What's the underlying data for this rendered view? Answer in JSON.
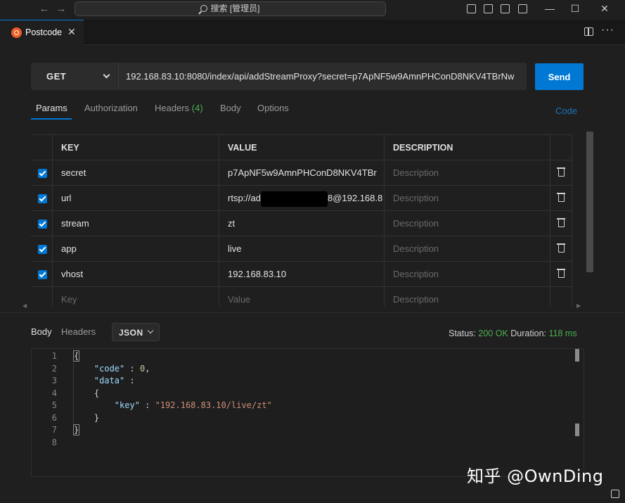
{
  "titlebar": {
    "search_text": "搜索 [管理员]"
  },
  "tab": {
    "label": "Postcode",
    "close": "✕"
  },
  "request": {
    "method": "GET",
    "url": "192.168.83.10:8080/index/api/addStreamProxy?secret=p7ApNF5w9AmnPHConD8NKV4TBrNw",
    "send_label": "Send"
  },
  "request_tabs": {
    "params": "Params",
    "authorization": "Authorization",
    "headers": "Headers",
    "headers_count": "(4)",
    "body": "Body",
    "options": "Options",
    "code": "Code"
  },
  "params_table": {
    "headers": {
      "key": "KEY",
      "value": "VALUE",
      "description": "DESCRIPTION"
    },
    "rows": [
      {
        "key": "secret",
        "value": "p7ApNF5w9AmnPHConD8NKV4TBr",
        "description": "Description",
        "checked": true
      },
      {
        "key": "url",
        "value_prefix": "rtsp://ad",
        "value_suffix": "8@192.168.8",
        "description": "Description",
        "checked": true
      },
      {
        "key": "stream",
        "value": "zt",
        "description": "Description",
        "checked": true
      },
      {
        "key": "app",
        "value": "live",
        "description": "Description",
        "checked": true
      },
      {
        "key": "vhost",
        "value": "192.168.83.10",
        "description": "Description",
        "checked": true
      }
    ],
    "new_row": {
      "key": "Key",
      "value": "Value",
      "description": "Description"
    }
  },
  "response": {
    "tab_body": "Body",
    "tab_headers": "Headers",
    "format": "JSON",
    "status_label": "Status:",
    "status_value": "200 OK",
    "duration_label": "Duration:",
    "duration_value": "118 ms",
    "line_numbers": [
      "1",
      "2",
      "3",
      "4",
      "5",
      "6",
      "7",
      "8"
    ],
    "json": {
      "open_brace": "{",
      "code_key": "\"code\"",
      "code_value": "0",
      "data_key": "\"data\"",
      "inner_open": "{",
      "key_key": "\"key\"",
      "key_value": "\"192.168.83.10/live/zt\"",
      "inner_close": "}",
      "close_brace": "}"
    }
  },
  "watermark": "知乎 @OwnDing",
  "colors": {
    "accent": "#0078d4",
    "ok_green": "#4caf50",
    "json_key": "#9cdcfe",
    "json_string": "#ce9178"
  }
}
